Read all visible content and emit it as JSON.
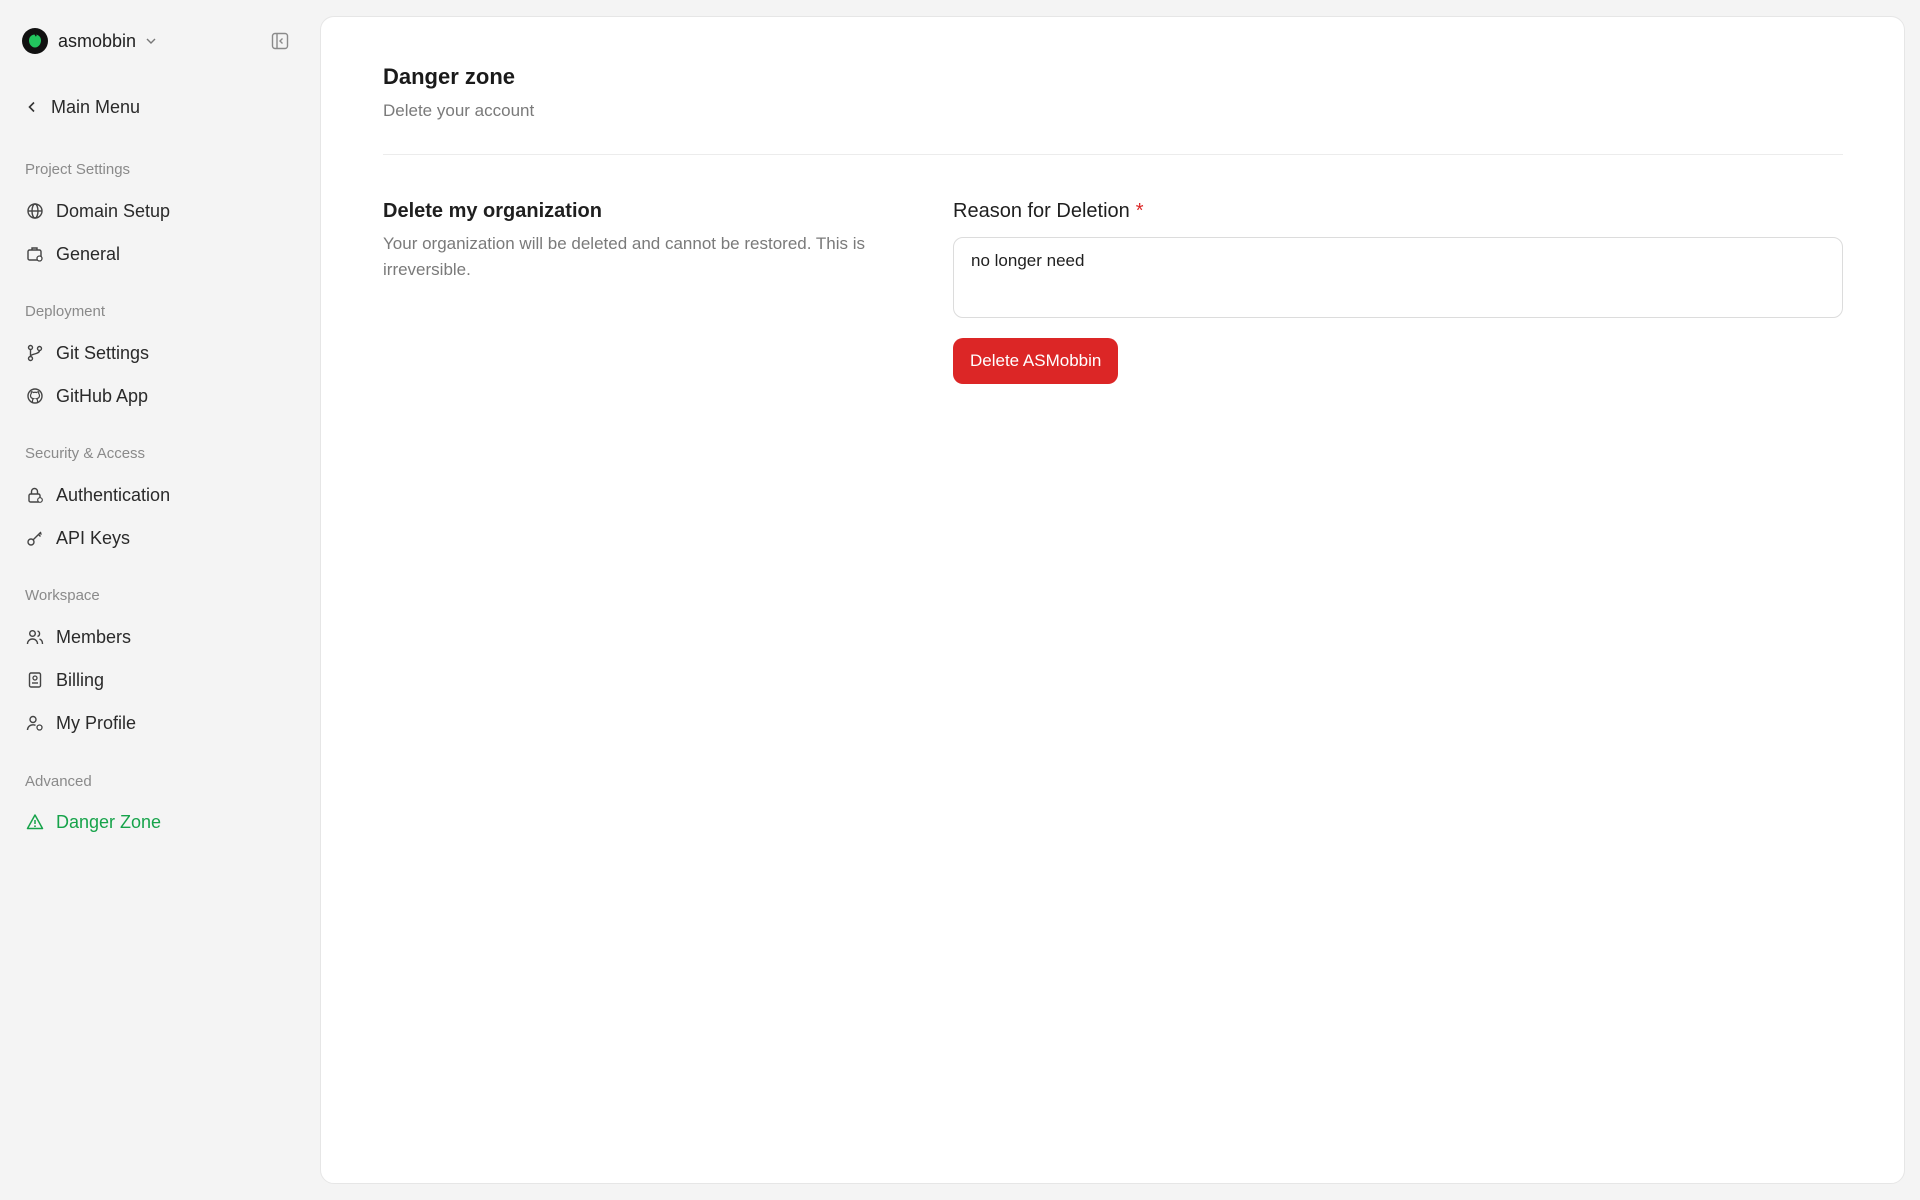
{
  "sidebar": {
    "org": {
      "name": "asmobbin"
    },
    "main_menu": "Main Menu",
    "sections": [
      {
        "title": "Project Settings",
        "items": [
          {
            "label": "Domain Setup",
            "icon": "globe-icon"
          },
          {
            "label": "General",
            "icon": "briefcase-gear-icon"
          }
        ]
      },
      {
        "title": "Deployment",
        "items": [
          {
            "label": "Git Settings",
            "icon": "git-branch-icon"
          },
          {
            "label": "GitHub App",
            "icon": "github-icon"
          }
        ]
      },
      {
        "title": "Security & Access",
        "items": [
          {
            "label": "Authentication",
            "icon": "lock-icon"
          },
          {
            "label": "API Keys",
            "icon": "key-icon"
          }
        ]
      },
      {
        "title": "Workspace",
        "items": [
          {
            "label": "Members",
            "icon": "users-icon"
          },
          {
            "label": "Billing",
            "icon": "receipt-icon"
          },
          {
            "label": "My Profile",
            "icon": "user-gear-icon"
          }
        ]
      },
      {
        "title": "Advanced",
        "items": [
          {
            "label": "Danger Zone",
            "icon": "warning-triangle-icon",
            "active": true
          }
        ]
      }
    ]
  },
  "main": {
    "title": "Danger zone",
    "subtitle": "Delete your account",
    "section": {
      "heading": "Delete my organization",
      "description": "Your organization will be deleted and cannot be restored. This is irreversible."
    },
    "reason_field": {
      "label": "Reason for Deletion",
      "required_mark": "*",
      "value": "no longer need"
    },
    "delete_button": "Delete ASMobbin"
  },
  "colors": {
    "accent": "#16a34a",
    "danger": "#dc2626",
    "background": "#f4f4f4",
    "panel": "#ffffff"
  }
}
